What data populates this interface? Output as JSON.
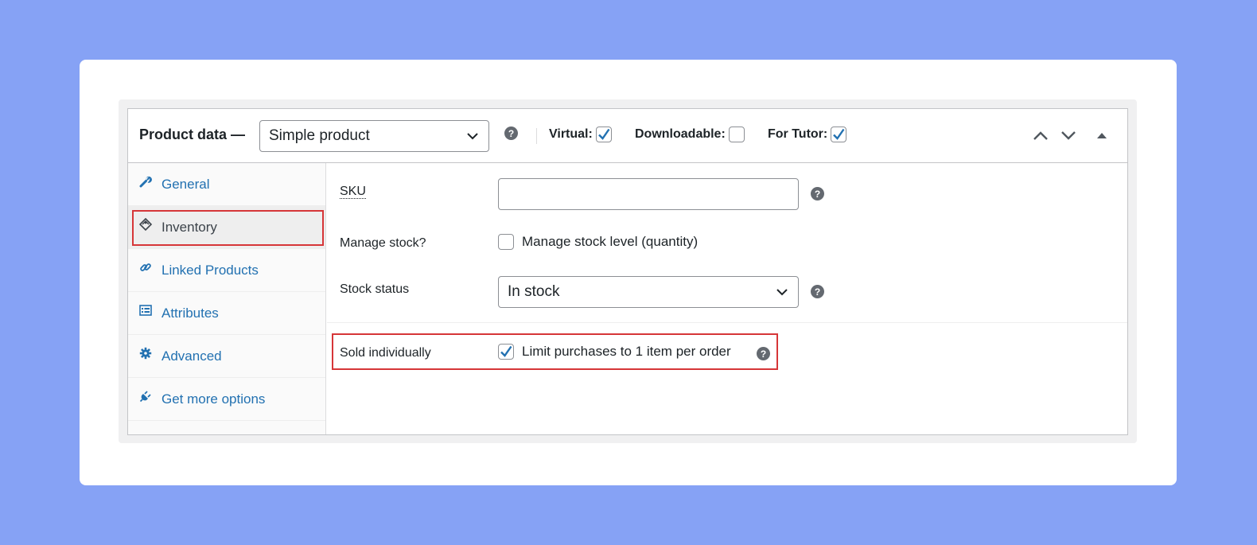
{
  "header": {
    "title": "Product data —",
    "product_type": "Simple product",
    "virtual_label": "Virtual:",
    "virtual_checked": true,
    "downloadable_label": "Downloadable:",
    "downloadable_checked": false,
    "for_tutor_label": "For Tutor:",
    "for_tutor_checked": true,
    "help_glyph": "?"
  },
  "tabs": [
    {
      "label": "General",
      "icon": "wrench-icon"
    },
    {
      "label": "Inventory",
      "icon": "tag-icon",
      "active": true
    },
    {
      "label": "Linked Products",
      "icon": "link-icon"
    },
    {
      "label": "Attributes",
      "icon": "list-icon"
    },
    {
      "label": "Advanced",
      "icon": "gear-icon"
    },
    {
      "label": "Get more options",
      "icon": "plug-icon"
    }
  ],
  "inventory": {
    "sku_label": "SKU",
    "sku_value": "",
    "manage_stock_label": "Manage stock?",
    "manage_stock_option": "Manage stock level (quantity)",
    "manage_stock_checked": false,
    "stock_status_label": "Stock status",
    "stock_status_value": "In stock",
    "sold_individually_label": "Sold individually",
    "sold_individually_option": "Limit purchases to 1 item per order",
    "sold_individually_checked": true
  },
  "colors": {
    "background": "#86a2f5",
    "link": "#2271b1",
    "highlight": "#d63638",
    "check": "#2271b1"
  }
}
